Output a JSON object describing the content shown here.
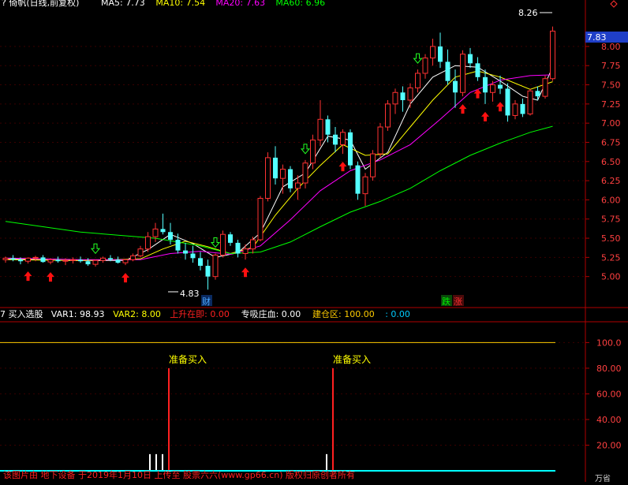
{
  "header": {
    "title_text": "? 倚帆(日线,前复权)",
    "ma_items": [
      {
        "label": "MA5: 7.73",
        "color": "#ffffff"
      },
      {
        "label": "MA10: 7.54",
        "color": "#ffff00"
      },
      {
        "label": "MA20: 7.63",
        "color": "#ff00ff"
      },
      {
        "label": "MA60: 6.96",
        "color": "#00ff00"
      }
    ]
  },
  "price_panel": {
    "current_price_badge": "7.83",
    "high_label": "8.26",
    "low_label": "4.83",
    "axis_ticks": [
      "8.00",
      "7.75",
      "7.50",
      "7.25",
      "7.00",
      "6.75",
      "6.50",
      "6.25",
      "6.00",
      "5.75",
      "5.50",
      "5.25",
      "5.00"
    ],
    "tags": [
      {
        "text": "财",
        "color": "#4aa8ff"
      },
      {
        "text": "跌",
        "color": "#00cc00"
      },
      {
        "text": "涨",
        "color": "#ff3030"
      }
    ]
  },
  "indicator_panel": {
    "legend": [
      {
        "text": "7 买入选股",
        "color": "#ffffff"
      },
      {
        "text": "VAR1: 98.93",
        "color": "#ffffff"
      },
      {
        "text": "VAR2: 8.00",
        "color": "#ffff00"
      },
      {
        "text": "上升在即: 0.00",
        "color": "#ff2020"
      },
      {
        "text": "专吸庄血: 0.00",
        "color": "#ffffff"
      },
      {
        "text": "建仓区: 100.00",
        "color": "#ffcc00"
      },
      {
        "text": ": 0.00",
        "color": "#00ccff"
      }
    ],
    "axis_ticks": [
      "100.0",
      "80.00",
      "60.00",
      "40.00",
      "20.00"
    ],
    "annotations": [
      "准备买入",
      "准备买入"
    ],
    "footer_text": "该图片由 地下设备 于2019年1月10日 上传至 股票六六(www.gp66.cn) 版权归原创者所有",
    "bottom_right": "万省"
  },
  "chart_data": {
    "type": "candlestick",
    "title": "",
    "ylim": [
      4.75,
      8.4
    ],
    "ohlc": [
      [
        5.22,
        5.26,
        5.18,
        5.24
      ],
      [
        5.24,
        5.28,
        5.2,
        5.22
      ],
      [
        5.22,
        5.25,
        5.16,
        5.2
      ],
      [
        5.2,
        5.25,
        5.17,
        5.24
      ],
      [
        5.24,
        5.27,
        5.2,
        5.25
      ],
      [
        5.25,
        5.28,
        5.18,
        5.19
      ],
      [
        5.19,
        5.24,
        5.16,
        5.22
      ],
      [
        5.22,
        5.26,
        5.18,
        5.2
      ],
      [
        5.2,
        5.24,
        5.15,
        5.21
      ],
      [
        5.21,
        5.25,
        5.17,
        5.22
      ],
      [
        5.22,
        5.26,
        5.18,
        5.2
      ],
      [
        5.2,
        5.24,
        5.14,
        5.16
      ],
      [
        5.16,
        5.22,
        5.13,
        5.21
      ],
      [
        5.21,
        5.26,
        5.18,
        5.24
      ],
      [
        5.24,
        5.28,
        5.2,
        5.22
      ],
      [
        5.22,
        5.26,
        5.17,
        5.18
      ],
      [
        5.18,
        5.23,
        5.15,
        5.22
      ],
      [
        5.22,
        5.3,
        5.2,
        5.27
      ],
      [
        5.27,
        5.4,
        5.25,
        5.36
      ],
      [
        5.36,
        5.58,
        5.32,
        5.52
      ],
      [
        5.52,
        5.7,
        5.45,
        5.62
      ],
      [
        5.62,
        5.82,
        5.55,
        5.58
      ],
      [
        5.58,
        5.7,
        5.42,
        5.48
      ],
      [
        5.48,
        5.56,
        5.3,
        5.34
      ],
      [
        5.34,
        5.44,
        5.22,
        5.3
      ],
      [
        5.3,
        5.4,
        5.18,
        5.24
      ],
      [
        5.24,
        5.32,
        5.08,
        5.14
      ],
      [
        5.14,
        5.22,
        4.83,
        5.0
      ],
      [
        5.0,
        5.3,
        4.96,
        5.28
      ],
      [
        5.28,
        5.6,
        5.25,
        5.55
      ],
      [
        5.55,
        5.58,
        5.4,
        5.44
      ],
      [
        5.44,
        5.48,
        5.25,
        5.3
      ],
      [
        5.3,
        5.42,
        5.22,
        5.36
      ],
      [
        5.36,
        5.52,
        5.3,
        5.48
      ],
      [
        5.48,
        6.05,
        5.46,
        6.02
      ],
      [
        6.02,
        6.62,
        5.98,
        6.55
      ],
      [
        6.55,
        6.7,
        6.2,
        6.28
      ],
      [
        6.28,
        6.46,
        6.08,
        6.4
      ],
      [
        6.4,
        6.44,
        6.1,
        6.15
      ],
      [
        6.15,
        6.32,
        6.0,
        6.22
      ],
      [
        6.22,
        6.52,
        6.15,
        6.48
      ],
      [
        6.48,
        6.85,
        6.4,
        6.78
      ],
      [
        6.78,
        7.3,
        6.7,
        7.05
      ],
      [
        7.05,
        7.1,
        6.75,
        6.85
      ],
      [
        6.85,
        6.95,
        6.62,
        6.72
      ],
      [
        6.72,
        6.92,
        6.6,
        6.88
      ],
      [
        6.88,
        6.92,
        6.4,
        6.45
      ],
      [
        6.45,
        6.5,
        6.0,
        6.08
      ],
      [
        6.08,
        6.35,
        5.92,
        6.3
      ],
      [
        6.3,
        6.65,
        6.25,
        6.6
      ],
      [
        6.6,
        7.0,
        6.55,
        6.95
      ],
      [
        6.95,
        7.3,
        6.9,
        7.25
      ],
      [
        7.25,
        7.45,
        7.12,
        7.4
      ],
      [
        7.4,
        7.48,
        7.15,
        7.3
      ],
      [
        7.3,
        7.52,
        7.2,
        7.46
      ],
      [
        7.46,
        7.7,
        7.4,
        7.65
      ],
      [
        7.65,
        7.9,
        7.58,
        7.85
      ],
      [
        7.85,
        8.1,
        7.75,
        8.0
      ],
      [
        8.0,
        8.18,
        7.72,
        7.8
      ],
      [
        7.8,
        7.96,
        7.5,
        7.55
      ],
      [
        7.55,
        7.7,
        7.2,
        7.4
      ],
      [
        7.4,
        7.95,
        7.35,
        7.9
      ],
      [
        7.9,
        7.98,
        7.72,
        7.78
      ],
      [
        7.78,
        7.86,
        7.55,
        7.6
      ],
      [
        7.6,
        7.7,
        7.25,
        7.4
      ],
      [
        7.4,
        7.55,
        7.28,
        7.5
      ],
      [
        7.5,
        7.62,
        7.38,
        7.45
      ],
      [
        7.45,
        7.52,
        7.02,
        7.1
      ],
      [
        7.1,
        7.3,
        7.05,
        7.25
      ],
      [
        7.25,
        7.32,
        7.08,
        7.12
      ],
      [
        7.12,
        7.45,
        7.1,
        7.42
      ],
      [
        7.42,
        7.48,
        7.3,
        7.35
      ],
      [
        7.35,
        7.62,
        7.32,
        7.58
      ],
      [
        7.58,
        8.26,
        7.55,
        8.2
      ]
    ],
    "ma_series": [
      {
        "name": "MA5",
        "color": "#ffffff",
        "points": [
          [
            0,
            5.23
          ],
          [
            8,
            5.21
          ],
          [
            16,
            5.21
          ],
          [
            19,
            5.35
          ],
          [
            22,
            5.55
          ],
          [
            25,
            5.43
          ],
          [
            28,
            5.25
          ],
          [
            31,
            5.31
          ],
          [
            34,
            5.57
          ],
          [
            37,
            6.17
          ],
          [
            40,
            6.35
          ],
          [
            43,
            6.83
          ],
          [
            46,
            6.78
          ],
          [
            48,
            6.4
          ],
          [
            51,
            6.62
          ],
          [
            54,
            7.25
          ],
          [
            57,
            7.6
          ],
          [
            60,
            7.75
          ],
          [
            63,
            7.73
          ],
          [
            66,
            7.55
          ],
          [
            69,
            7.35
          ],
          [
            71,
            7.3
          ],
          [
            73,
            7.73
          ]
        ]
      },
      {
        "name": "MA10",
        "color": "#ffff00",
        "points": [
          [
            0,
            5.22
          ],
          [
            10,
            5.21
          ],
          [
            18,
            5.23
          ],
          [
            21,
            5.36
          ],
          [
            24,
            5.46
          ],
          [
            27,
            5.39
          ],
          [
            30,
            5.3
          ],
          [
            33,
            5.38
          ],
          [
            36,
            5.8
          ],
          [
            39,
            6.15
          ],
          [
            42,
            6.45
          ],
          [
            45,
            6.72
          ],
          [
            48,
            6.58
          ],
          [
            51,
            6.6
          ],
          [
            54,
            6.95
          ],
          [
            57,
            7.3
          ],
          [
            60,
            7.6
          ],
          [
            63,
            7.68
          ],
          [
            66,
            7.6
          ],
          [
            70,
            7.44
          ],
          [
            73,
            7.54
          ]
        ]
      },
      {
        "name": "MA20",
        "color": "#ff00ff",
        "points": [
          [
            0,
            5.24
          ],
          [
            10,
            5.22
          ],
          [
            18,
            5.22
          ],
          [
            22,
            5.3
          ],
          [
            26,
            5.33
          ],
          [
            30,
            5.29
          ],
          [
            34,
            5.4
          ],
          [
            38,
            5.74
          ],
          [
            42,
            6.12
          ],
          [
            46,
            6.38
          ],
          [
            50,
            6.52
          ],
          [
            54,
            6.72
          ],
          [
            58,
            7.05
          ],
          [
            62,
            7.4
          ],
          [
            66,
            7.56
          ],
          [
            70,
            7.62
          ],
          [
            73,
            7.63
          ]
        ]
      },
      {
        "name": "MA60",
        "color": "#00ff00",
        "points": [
          [
            0,
            5.72
          ],
          [
            10,
            5.58
          ],
          [
            20,
            5.5
          ],
          [
            26,
            5.4
          ],
          [
            30,
            5.3
          ],
          [
            34,
            5.32
          ],
          [
            38,
            5.45
          ],
          [
            42,
            5.65
          ],
          [
            46,
            5.84
          ],
          [
            50,
            5.98
          ],
          [
            54,
            6.15
          ],
          [
            58,
            6.38
          ],
          [
            62,
            6.58
          ],
          [
            66,
            6.74
          ],
          [
            70,
            6.88
          ],
          [
            73,
            6.96
          ]
        ]
      }
    ],
    "buy_arrow_bars": [
      3,
      6,
      16,
      32,
      45,
      61,
      63,
      64,
      66
    ],
    "sell_arrow_bars": [
      12,
      28,
      40,
      55
    ],
    "indicator": {
      "ylim": [
        0,
        115
      ],
      "line_value": 100,
      "bars": [
        {
          "bar": 14,
          "value": 13,
          "color": "#ffffff"
        },
        {
          "bar": 15,
          "value": 13,
          "color": "#ffffff"
        },
        {
          "bar": 16,
          "value": 13,
          "color": "#ffffff"
        },
        {
          "bar": 17,
          "value": 80,
          "color": "#ff2020"
        },
        {
          "bar": 39,
          "value": 13,
          "color": "#ffffff"
        },
        {
          "bar": 40,
          "value": 80,
          "color": "#ff2020"
        }
      ]
    }
  }
}
